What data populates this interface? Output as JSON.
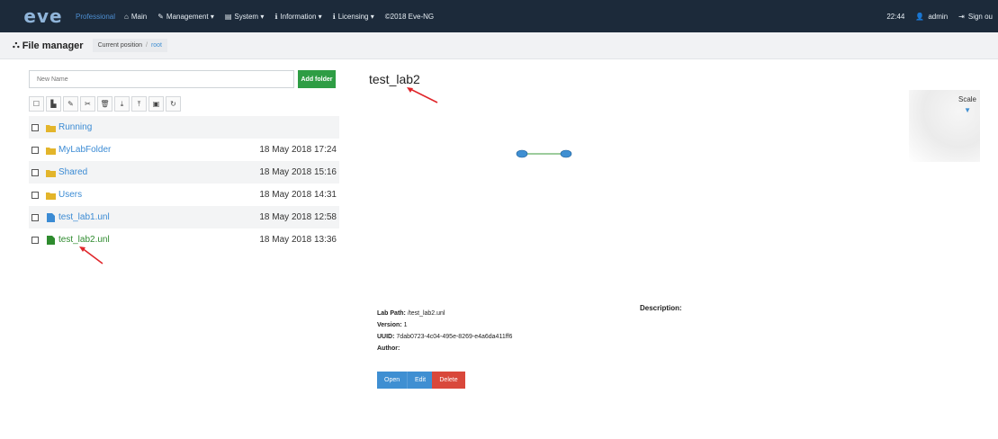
{
  "header": {
    "logo_text": "eve",
    "edition": "Professional",
    "nav": [
      {
        "label": "Main",
        "icon": "home-icon",
        "glyph": "⌂"
      },
      {
        "label": "Management ▾",
        "icon": "wrench-icon",
        "glyph": "✎"
      },
      {
        "label": "System ▾",
        "icon": "hdd-icon",
        "glyph": "▤"
      },
      {
        "label": "Information ▾",
        "icon": "info-icon",
        "glyph": "ℹ"
      },
      {
        "label": "Licensing ▾",
        "icon": "info-icon",
        "glyph": "ℹ"
      }
    ],
    "copyright": "©2018 Eve-NG",
    "time": "22:44",
    "user": "admin",
    "signout": "Sign ou"
  },
  "subbar": {
    "title": "File manager",
    "crumb_label": "Current position",
    "crumb_sep": "/",
    "crumb_root": "root"
  },
  "left": {
    "name_placeholder": "New Name",
    "add_folder": "Add folder",
    "toolbar": [
      {
        "name": "select-all-icon",
        "glyph": "☐"
      },
      {
        "name": "new-file-icon",
        "glyph": "▙"
      },
      {
        "name": "edit-icon",
        "glyph": "✎"
      },
      {
        "name": "cut-icon",
        "glyph": "✂"
      },
      {
        "name": "delete-icon",
        "glyph": "🗑"
      },
      {
        "name": "export-icon",
        "glyph": "⤓"
      },
      {
        "name": "import-icon",
        "glyph": "⤒"
      },
      {
        "name": "save-icon",
        "glyph": "▣"
      },
      {
        "name": "refresh-icon",
        "glyph": "↻"
      }
    ],
    "rows": [
      {
        "name": "Running",
        "type": "folder",
        "date": ""
      },
      {
        "name": "MyLabFolder",
        "type": "folder",
        "date": "18 May 2018 17:24"
      },
      {
        "name": "Shared",
        "type": "folder",
        "date": "18 May 2018 15:16"
      },
      {
        "name": "Users",
        "type": "folder",
        "date": "18 May 2018 14:31"
      },
      {
        "name": "test_lab1.unl",
        "type": "file",
        "date": "18 May 2018 12:58"
      },
      {
        "name": "test_lab2.unl",
        "type": "file-active",
        "date": "18 May 2018 13:36"
      }
    ]
  },
  "preview": {
    "title": "test_lab2",
    "scale_label": "Scale",
    "scale_arrow": "▼",
    "lab_path_label": "Lab Path:",
    "lab_path": "/test_lab2.unl",
    "version_label": "Version:",
    "version": "1",
    "uuid_label": "UUID:",
    "uuid": "7dab0723-4c04-495e-8269-e4a6da411ff6",
    "author_label": "Author:",
    "description_label": "Description:",
    "open": "Open",
    "edit": "Edit",
    "delete": "Delete"
  },
  "colors": {
    "topbar": "#1c2a3a",
    "accent_blue": "#3f8fd2",
    "accent_green": "#2e9d44",
    "danger": "#d9483b",
    "folder": "#e3b52b",
    "annotation_arrow": "#e0262b"
  }
}
